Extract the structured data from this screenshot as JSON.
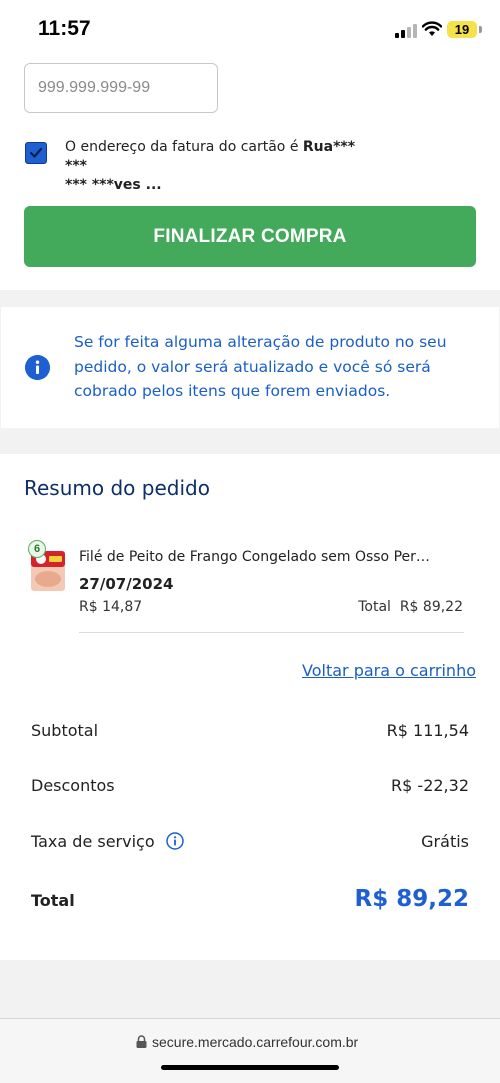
{
  "status_bar": {
    "time": "11:57",
    "battery": "19"
  },
  "payment": {
    "cpf_placeholder": "999.999.999-99",
    "billing_address_prefix": "O endereço da fatura do cartão é ",
    "billing_address_masked_1": "Rua*** ***",
    "billing_address_masked_2": "*** ***ves ...",
    "billing_address_checked": true,
    "finalize_label": "FINALIZAR COMPRA"
  },
  "info_notice": {
    "text": "Se for feita alguma alteração de produto no seu pedido, o valor será atualizado e você só será cobrado pelos itens que forem enviados."
  },
  "order_summary": {
    "title": "Resumo do pedido",
    "items": [
      {
        "quantity": "6",
        "name": "Filé de Peito de Frango Congelado sem Osso Per…",
        "date": "27/07/2024",
        "unit_price": "R$ 14,87",
        "total_label": "Total",
        "total_value": "R$ 89,22"
      }
    ],
    "back_to_cart": "Voltar para o carrinho",
    "subtotal_label": "Subtotal",
    "subtotal_value": "R$ 111,54",
    "discounts_label": "Descontos",
    "discounts_value": "R$ -22,32",
    "service_fee_label": "Taxa de serviço",
    "service_fee_value": "Grátis",
    "total_label": "Total",
    "total_value": "R$ 89,22"
  },
  "url_bar": {
    "url": "secure.mercado.carrefour.com.br"
  },
  "colors": {
    "primary_blue": "#1e5fd1",
    "finalize_green": "#43a95b",
    "title_navy": "#0c2f6b"
  }
}
